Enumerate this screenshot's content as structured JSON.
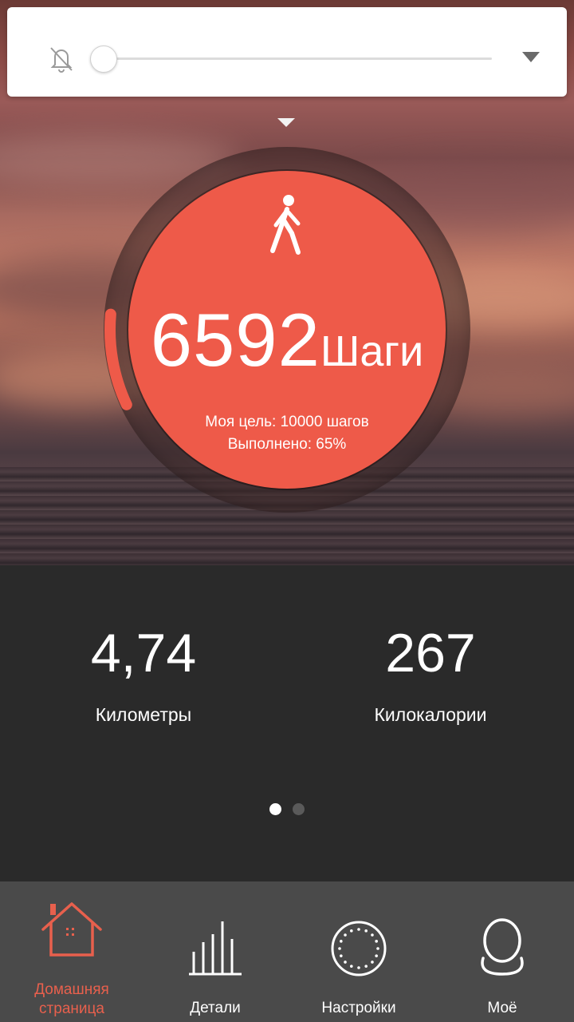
{
  "notification": {
    "bell_icon": "bell-off-icon",
    "slider_value": 0
  },
  "step_counter": {
    "icon": "walking-person-icon",
    "steps": "6592",
    "unit": "Шаги",
    "goal_text": "Моя цель: 10000 шагов",
    "progress_text": "Выполнено: 65%",
    "progress_fraction": 0.65,
    "accent_color": "#ee5a49"
  },
  "stats": [
    {
      "value": "4,74",
      "label": "Километры"
    },
    {
      "value": "267",
      "label": "Килокалории"
    }
  ],
  "pager": {
    "pages": 2,
    "active": 0
  },
  "tabs": [
    {
      "label": "Домашняя\nстраница",
      "icon": "home-icon",
      "active": true
    },
    {
      "label": "Детали",
      "icon": "bar-chart-icon",
      "active": false
    },
    {
      "label": "Настройки",
      "icon": "dotted-circle-icon",
      "active": false
    },
    {
      "label": "Моё",
      "icon": "user-icon",
      "active": false
    }
  ],
  "colors": {
    "active_tab": "#e8604d",
    "inactive_tab": "#ffffff"
  }
}
